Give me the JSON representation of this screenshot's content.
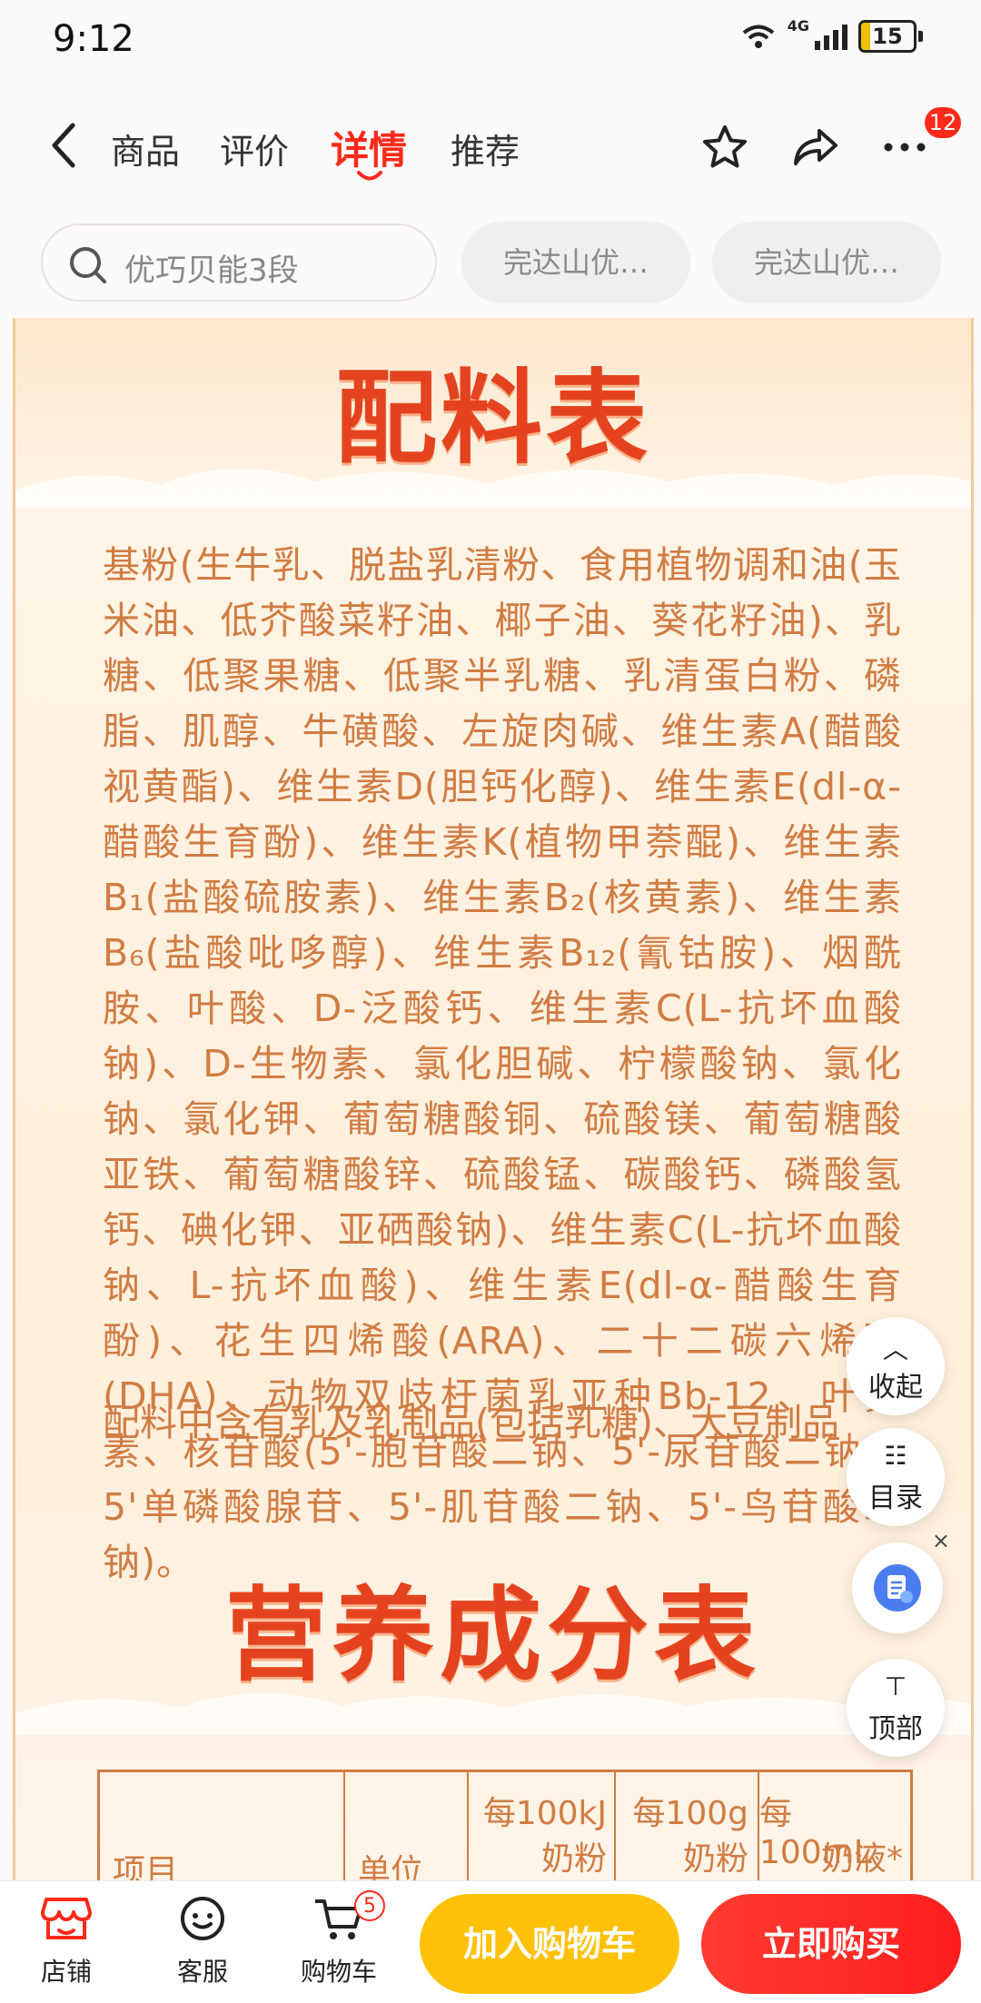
{
  "status_bar": {
    "time": "9:12",
    "network": "4G",
    "battery": "15"
  },
  "nav": {
    "tabs": [
      {
        "label": "商品"
      },
      {
        "label": "评价"
      },
      {
        "label": "详情"
      },
      {
        "label": "推荐"
      }
    ],
    "more_badge": "12"
  },
  "search": {
    "placeholder": "优巧贝能3段",
    "chips": [
      "完达山优…",
      "完达山优…"
    ]
  },
  "poster": {
    "title1": "配料表",
    "ingredients": "基粉(生牛乳、脱盐乳清粉、食用植物调和油(玉米油、低芥酸菜籽油、椰子油、葵花籽油)、乳糖、低聚果糖、低聚半乳糖、乳清蛋白粉、磷脂、肌醇、牛磺酸、左旋肉碱、维生素A(醋酸视黄酯)、维生素D(胆钙化醇)、维生素E(dl-α-醋酸生育酚)、维生素K(植物甲萘醌)、维生素B₁(盐酸硫胺素)、维生素B₂(核黄素)、维生素B₆(盐酸吡哆醇)、维生素B₁₂(氰钴胺)、烟酰胺、叶酸、D-泛酸钙、维生素C(L-抗坏血酸钠)、D-生物素、氯化胆碱、柠檬酸钠、氯化钠、氯化钾、葡萄糖酸铜、硫酸镁、葡萄糖酸亚铁、葡萄糖酸锌、硫酸锰、碳酸钙、磷酸氢钙、碘化钾、亚硒酸钠)、维生素C(L-抗坏血酸钠、L-抗坏血酸)、维生素E(dl-α-醋酸生育酚)、花生四烯酸(ARA)、二十二碳六烯酸(DHA)、动物双歧杆菌乳亚种Bb-12、叶黄素、核苷酸(5'-胞苷酸二钠、5'-尿苷酸二钠、5'单磷酸腺苷、5'-肌苷酸二钠、5'-鸟苷酸二钠)。",
    "allergen": "配料中含有乳及乳制品(包括乳糖)、大豆制品",
    "title2": "营养成分表",
    "table_headers": [
      {
        "line1": "项目",
        "line2": ""
      },
      {
        "line1": "单位",
        "line2": ""
      },
      {
        "line1": "每100kJ",
        "line2": "奶粉"
      },
      {
        "line1": "每100g",
        "line2": "奶粉"
      },
      {
        "line1": "每100mL",
        "line2": "奶液*"
      }
    ]
  },
  "floating": {
    "collapse": "收起",
    "collapse_glyph": "︿",
    "toc": "目录",
    "toc_glyph": "☷",
    "top": "顶部",
    "top_glyph": "⊤",
    "close_glyph": "×"
  },
  "bottom_bar": {
    "store": "店铺",
    "service": "客服",
    "cart": "购物车",
    "cart_badge": "5",
    "add_to_cart": "加入购物车",
    "buy_now": "立即购买"
  },
  "colors": {
    "accent": "#ff2a1a",
    "poster_text": "#d07c43",
    "poster_title": "#e5431f",
    "add_cart": "#ffc107",
    "buy": "#ff2a1a"
  },
  "icons": [
    "back-icon",
    "star-icon",
    "share-icon",
    "more-icon",
    "search-icon",
    "store-icon",
    "service-icon",
    "cart-icon",
    "doc-icon"
  ]
}
